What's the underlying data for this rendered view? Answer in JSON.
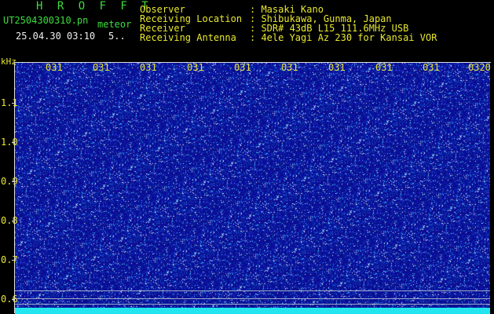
{
  "header": {
    "title": "H R O F F T",
    "filename": "UT2504300310.pn",
    "meteor_label": "meteor",
    "datetime": "25.04.30 03:10",
    "counter": "5.."
  },
  "info": {
    "observer_label": "Observer",
    "observer_value": ": Masaki Kano",
    "location_label": "Receiving Location",
    "location_value": ": Shibukawa, Gunma, Japan",
    "receiver_label": "Receiver",
    "receiver_value": ": SDR# 43dB L15 111.6MHz USB",
    "antenna_label": "Receiving Antenna",
    "antenna_value": ": 4ele Yagi Az 230 for Kansai VOR"
  },
  "axes": {
    "y_unit": "kHz",
    "x_ticks": [
      "031",
      "031",
      "031",
      "031",
      "031",
      "031",
      "031",
      "031",
      "031",
      "0320"
    ],
    "y_ticks": [
      "1.1",
      "1.0",
      "0.9",
      "0.8",
      "0.7",
      "0.6"
    ]
  },
  "colors": {
    "background": "#0a0a96",
    "noise_white": "#ffffff",
    "noise_cyan": "#3cc8ff",
    "baseline": "#22e5f0"
  }
}
